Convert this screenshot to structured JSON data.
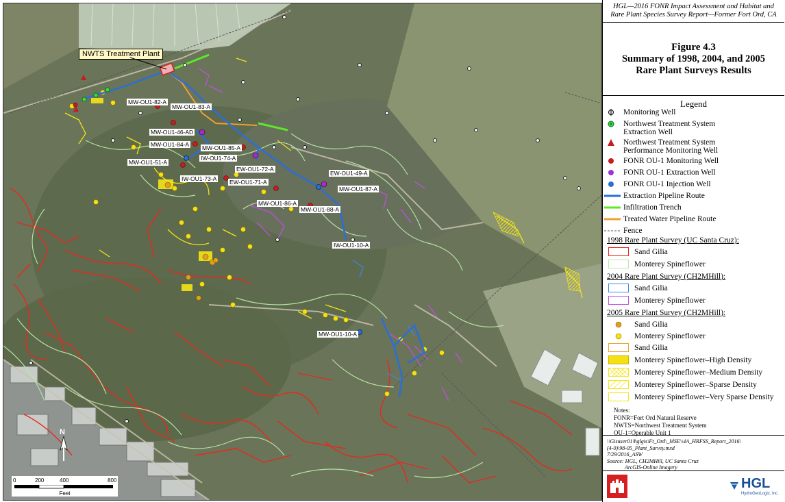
{
  "header": {
    "line1": "HGL—2016 FONR Impact Assessment and Habitat and",
    "line2": "Rare Plant Species Survey Report—Former Fort Ord, CA"
  },
  "figure": {
    "number": "Figure 4.3",
    "title1": "Summary of 1998, 2004, and 2005",
    "title2": "Rare Plant Surveys Results"
  },
  "legend": {
    "title": "Legend",
    "items": [
      {
        "label": "Monitoring Well",
        "icon": "monitoring-well-icon"
      },
      {
        "label": "Northwest Treatment System",
        "label2": "Extraction Well",
        "icon": "green-dot-icon"
      },
      {
        "label": "Northwest Treatment System",
        "label2": "Performance Monitoring Well",
        "icon": "red-triangle-icon"
      },
      {
        "label": "FONR OU-1 Monitoring Well",
        "icon": "red-dot-icon"
      },
      {
        "label": "FONR OU-1 Extraction Well",
        "icon": "purple-dot-icon"
      },
      {
        "label": "FONR OU-1 Injection Well",
        "icon": "blue-dot-icon"
      },
      {
        "label": "Extraction Pipeline Route",
        "icon": "blue-line-icon"
      },
      {
        "label": "Infiltration Trench",
        "icon": "green-line-icon"
      },
      {
        "label": "Treated Water Pipeline Route",
        "icon": "orange-line-icon"
      },
      {
        "label": "Fence",
        "icon": "fence-line-icon"
      }
    ],
    "survey1998": {
      "title": "1998 Rare Plant Survey (UC Santa Cruz):",
      "items": [
        "Sand Gilia",
        "Monterey Spineflower"
      ]
    },
    "survey2004": {
      "title": "2004 Rare Plant Survey (CH2MHill):",
      "items": [
        "Sand Gilia",
        "Monterey Spineflower"
      ]
    },
    "survey2005": {
      "title": "2005 Rare Plant Survey (CH2MHill):",
      "items": [
        "Sand Gilia",
        "Monterey Spineflower",
        "Sand Gilia",
        "Monterey Spineflower–High Density",
        "Monterey Spineflower–Medium Density",
        "Monterey Spineflower–Sparse Density",
        "Monterey Spineflower–Very Sparse Density"
      ]
    },
    "notes": [
      "Notes:",
      "FONR=Fort Ord Natural Reserve",
      "NWTS=Northwest Treatment System",
      "OU-1=Operable Unit 1"
    ]
  },
  "source": {
    "lines": [
      "\\\\Gisuser01\\hglgis\\Ft_Ord\\_MSE\\\\4A_HRFSS_Report_2016\\",
      "(4-0)\\98-05_Plant_Survey.mxd",
      "7/29/2016_ASW",
      "Source: HGL, CH2MHill, UC Santa Cruz",
      "ArcGIS-Online Imagery"
    ]
  },
  "logo": {
    "company": "HGL",
    "company_sub": "HydroGeoLogic, Inc."
  },
  "map": {
    "plant_label": "NWTS Treatment Plant",
    "north": "N",
    "scale_ticks": [
      "0",
      "200",
      "400",
      "800"
    ],
    "scale_unit": "Feet",
    "well_labels": [
      "MW-OU1-82-A",
      "MW-OU1-83-A",
      "MW-OU1-46-AD",
      "MW-OU1-84-A",
      "MW-OU1-85-A",
      "IW-OU1-74-A",
      "MW-OU1-51-A",
      "EW-OU1-72-A",
      "IW-OU1-73-A",
      "EW-OU1-71-A",
      "EW-OU1-49-A",
      "MW-OU1-87-A",
      "MW-OU1-86-A",
      "MW-OU1-88-A",
      "IW-OU1-10-A",
      "MW-OU1-10-A"
    ]
  },
  "colors": {
    "extraction": "#2a6fd6",
    "trench": "#5ee82a",
    "treated": "#f0a030",
    "sand_gilia_1998": "#e8281e",
    "spineflower_1998": "#b8e8a8",
    "sand_gilia_2004": "#3a8ae8",
    "spineflower_2004": "#c050e0",
    "sand_gilia_2005": "#e0a020",
    "spineflower_2005": "#f4e418"
  }
}
